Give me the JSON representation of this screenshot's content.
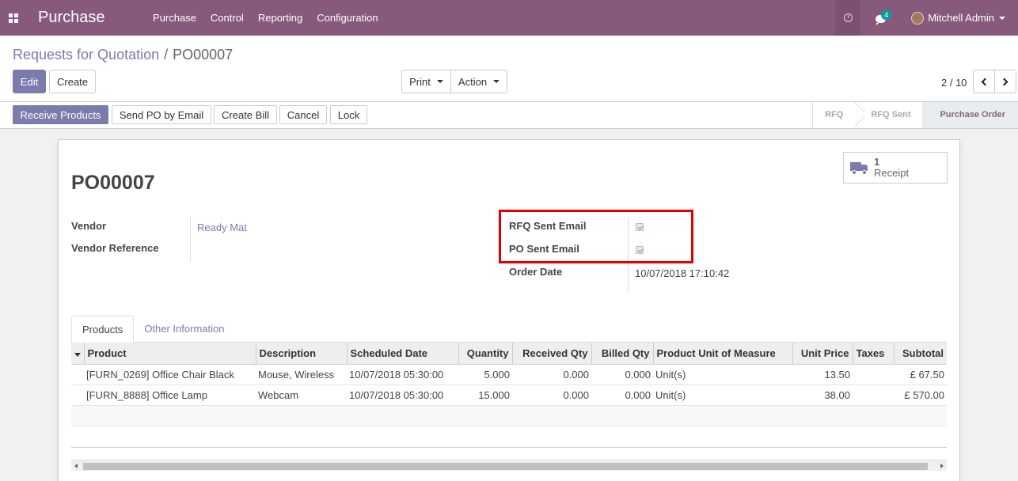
{
  "navbar": {
    "app_title": "Purchase",
    "menu": [
      "Purchase",
      "Control",
      "Reporting",
      "Configuration"
    ],
    "chat_count": "4",
    "user_name": "Mitchell Admin"
  },
  "breadcrumb": {
    "parent": "Requests for Quotation",
    "separator": "/",
    "current": "PO00007"
  },
  "control": {
    "edit": "Edit",
    "create": "Create",
    "print": "Print",
    "action": "Action",
    "pager": "2 / 10"
  },
  "statusbar": {
    "buttons": [
      "Receive Products",
      "Send PO by Email",
      "Create Bill",
      "Cancel",
      "Lock"
    ],
    "stages": [
      "RFQ",
      "RFQ Sent",
      "Purchase Order"
    ],
    "active_stage": "Purchase Order"
  },
  "form": {
    "name": "PO00007",
    "smart_button": {
      "count": "1",
      "label": "Receipt",
      "icon": "truck-icon"
    },
    "vendor_label": "Vendor",
    "vendor_value": "Ready Mat",
    "vendor_ref_label": "Vendor Reference",
    "rfq_sent_label": "RFQ Sent Email",
    "rfq_sent_checked": true,
    "po_sent_label": "PO Sent Email",
    "po_sent_checked": true,
    "order_date_label": "Order Date",
    "order_date_value": "10/07/2018 17:10:42"
  },
  "tabs": [
    "Products",
    "Other Information"
  ],
  "table": {
    "columns": [
      "Product",
      "Description",
      "Scheduled Date",
      "Quantity",
      "Received Qty",
      "Billed Qty",
      "Product Unit of Measure",
      "Unit Price",
      "Taxes",
      "Subtotal"
    ],
    "rows": [
      [
        "[FURN_0269] Office Chair Black",
        "Mouse, Wireless",
        "10/07/2018 05:30:00",
        "5.000",
        "0.000",
        "0.000",
        "Unit(s)",
        "13.50",
        "",
        "£ 67.50"
      ],
      [
        "[FURN_8888] Office Lamp",
        "Webcam",
        "10/07/2018 05:30:00",
        "15.000",
        "0.000",
        "0.000",
        "Unit(s)",
        "38.00",
        "",
        "£ 570.00"
      ]
    ]
  },
  "colors": {
    "brand": "#875a7b",
    "primary": "#7c7bad",
    "highlight": "#e00000"
  }
}
